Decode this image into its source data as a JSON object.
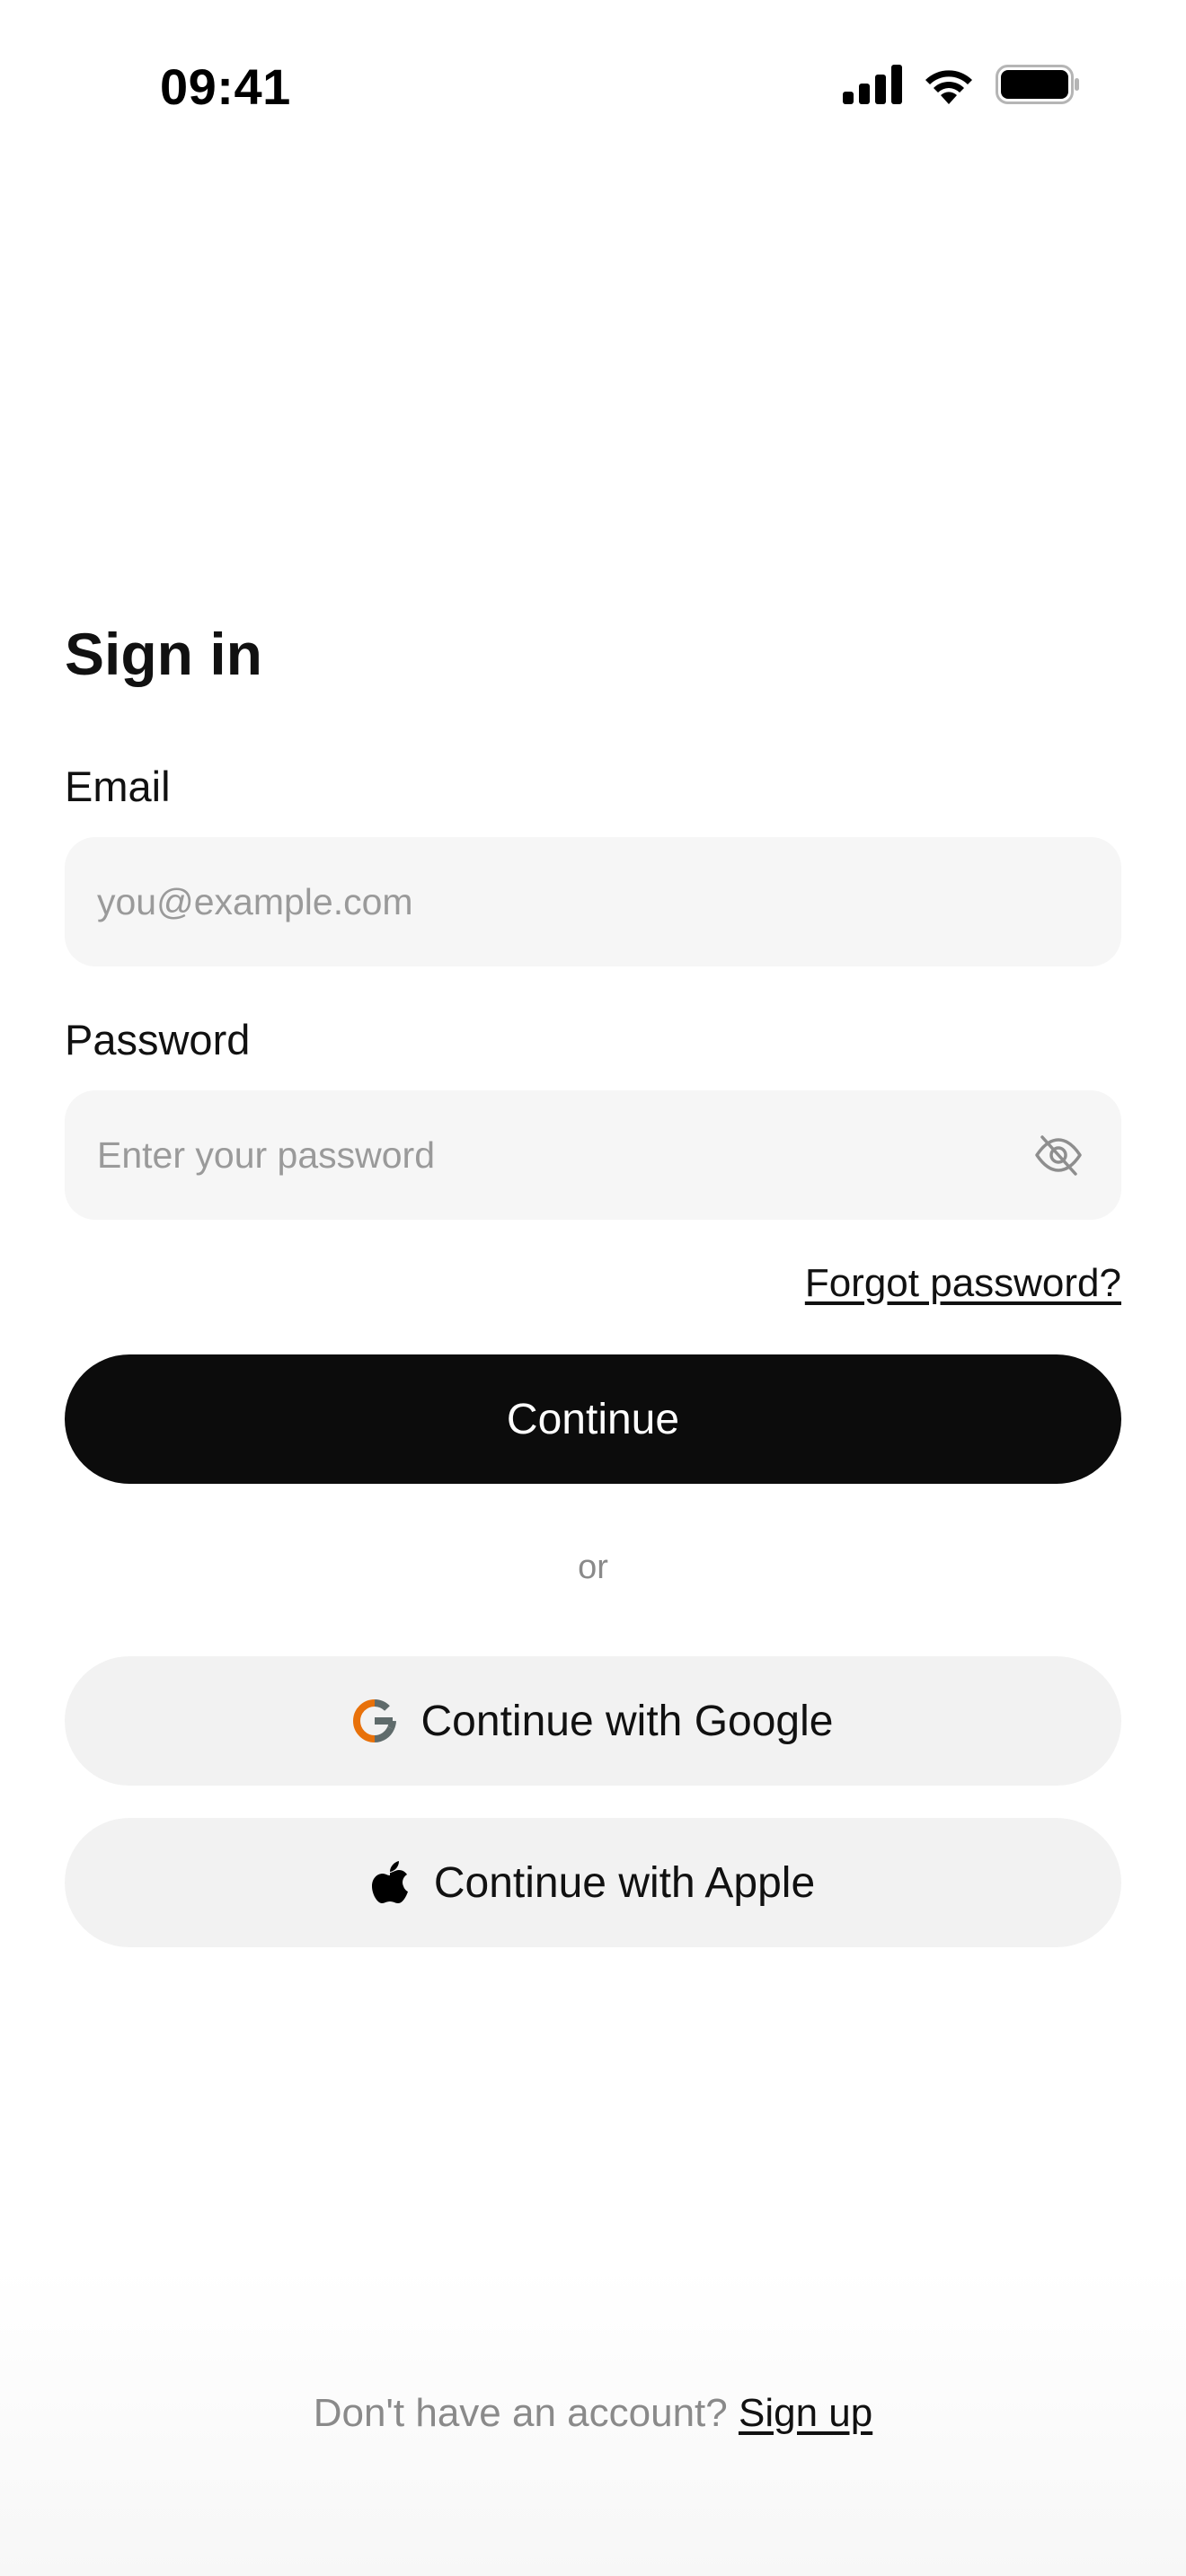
{
  "status_bar": {
    "time": "09:41",
    "icons": [
      "cellular-signal-icon",
      "wifi-icon",
      "battery-icon"
    ]
  },
  "form": {
    "title": "Sign in",
    "email_label": "Email",
    "email_placeholder": "you@example.com",
    "email_value": "",
    "password_label": "Password",
    "password_placeholder": "Enter your password",
    "password_value": "",
    "password_toggle_icon": "eye-off-icon",
    "forgot_link": "Forgot password?",
    "continue_label": "Continue"
  },
  "divider": {
    "label": "or"
  },
  "social": {
    "google_label": "Continue with Google",
    "google_icon": "google-icon",
    "apple_label": "Continue with Apple",
    "apple_icon": "apple-icon"
  },
  "footer": {
    "prompt": "Don't have an account?",
    "signup_link": "Sign up"
  },
  "colors": {
    "primary_button": "#0c0c0c",
    "input_background": "#f6f6f6",
    "secondary_button": "#f2f2f2",
    "muted_text": "#8a8a8a"
  }
}
